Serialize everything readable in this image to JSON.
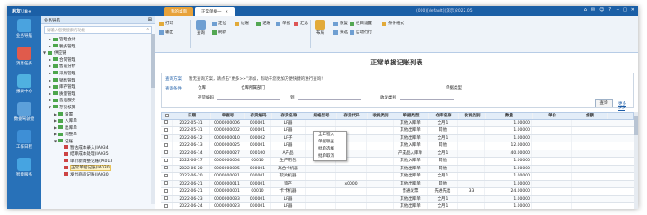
{
  "app": {
    "title": "用友U8+",
    "status": "(000)[default](演示)2022.05",
    "toolbar_right": [
      "首",
      "消息中心",
      "导航",
      "帮助"
    ],
    "tabs": [
      {
        "label": "我的桌面",
        "active": false
      },
      {
        "label": "正常单据一",
        "active": true
      }
    ]
  },
  "modules": [
    {
      "label": "业务导航",
      "color": "#4aa3df"
    },
    {
      "label": "消息任务",
      "color": "#e05b4c"
    },
    {
      "label": "报表中心",
      "color": "#4fb1e0"
    },
    {
      "label": "数据驾驶舱",
      "color": "#5ca0da"
    },
    {
      "label": "工作日程",
      "color": "#3e8fd6"
    },
    {
      "label": "智能服务",
      "color": "#46a4e1"
    }
  ],
  "nav": {
    "title": "业务导航",
    "search_placeholder": "请输入您要搜索的功能",
    "tree": [
      {
        "label": "管理会计",
        "arrow": "▶",
        "indent": 1,
        "icon": "green",
        "selected": false
      },
      {
        "label": "税务管理",
        "arrow": "▶",
        "indent": 1,
        "icon": "green",
        "selected": false
      },
      {
        "label": "供应链",
        "arrow": "▼",
        "indent": 0,
        "icon": "green",
        "selected": false
      },
      {
        "label": "合同管理",
        "arrow": "▶",
        "indent": 1,
        "icon": "green",
        "selected": false
      },
      {
        "label": "售前分析",
        "arrow": "▶",
        "indent": 1,
        "icon": "green",
        "selected": false
      },
      {
        "label": "采购管理",
        "arrow": "▶",
        "indent": 1,
        "icon": "green",
        "selected": false
      },
      {
        "label": "销售管理",
        "arrow": "▶",
        "indent": 1,
        "icon": "green",
        "selected": false
      },
      {
        "label": "库存管理",
        "arrow": "▶",
        "indent": 1,
        "icon": "green",
        "selected": false
      },
      {
        "label": "质量管理",
        "arrow": "▶",
        "indent": 1,
        "icon": "green",
        "selected": false
      },
      {
        "label": "售后服务",
        "arrow": "▶",
        "indent": 1,
        "icon": "green",
        "selected": false
      },
      {
        "label": "存货核算",
        "arrow": "▼",
        "indent": 1,
        "icon": "green",
        "selected": false
      },
      {
        "label": "设置",
        "arrow": "▶",
        "indent": 2,
        "icon": "green",
        "selected": false
      },
      {
        "label": "入库单",
        "arrow": "▶",
        "indent": 2,
        "icon": "green",
        "selected": false
      },
      {
        "label": "出库单",
        "arrow": "▶",
        "indent": 2,
        "icon": "green",
        "selected": false
      },
      {
        "label": "调整单",
        "arrow": "▶",
        "indent": 2,
        "icon": "green",
        "selected": false
      },
      {
        "label": "记账",
        "arrow": "▼",
        "indent": 2,
        "icon": "green",
        "selected": false
      },
      {
        "label": "暂估成本录入(IA034",
        "arrow": "",
        "indent": 3,
        "icon": "red",
        "selected": false
      },
      {
        "label": "结算成本处理(IA035",
        "arrow": "",
        "indent": 3,
        "icon": "red",
        "selected": false
      },
      {
        "label": "单价新调整记账(IA013",
        "arrow": "",
        "indent": 3,
        "icon": "red",
        "selected": false
      },
      {
        "label": "正常单据记账(IA030",
        "arrow": "",
        "indent": 3,
        "icon": "red",
        "selected": true
      },
      {
        "label": "发出商品记账(IA030",
        "arrow": "",
        "indent": 3,
        "icon": "red",
        "selected": false
      }
    ]
  },
  "ribbon": {
    "buttons": [
      "打印",
      "输出",
      "查询",
      "定位",
      "刷新",
      "过账",
      "记账",
      "单据",
      "汇总",
      "布局",
      "恢复",
      "栏目设置",
      "筛选",
      "自动行行",
      "条件格式"
    ]
  },
  "report": {
    "title": "正常单据记账列表",
    "query": {
      "plan_label": "查询方案:",
      "plan_hint": "暂无查询方案，请点击“更多>>”添加，有助于您更加方便快捷的进行查询!",
      "cond_label": "查询条件:",
      "fields": [
        "仓库",
        "仓库所属部门",
        "单据类型",
        "存货编码",
        "到",
        "收发类别"
      ],
      "to_label": "到",
      "btn_query": "查询",
      "more": "更多>>"
    },
    "columns": [
      "日期",
      "单据号",
      "存货编码",
      "存货名称",
      "规格型号",
      "存货代码",
      "收发类别",
      "单据类型",
      "仓库名称",
      "收发类别",
      "数量",
      "单价",
      "金额"
    ],
    "rows": [
      [
        "2022-05-31",
        "0000000006",
        "000001",
        "LP器",
        "",
        "",
        "",
        "其他入库单",
        "全月1",
        "",
        "1.00000",
        "",
        ""
      ],
      [
        "2022-05-31",
        "0000000002",
        "000001",
        "LP器",
        "",
        "",
        "",
        "其他出库单",
        "其他",
        "",
        "1.00000",
        "",
        ""
      ],
      [
        "2022-06-12",
        "0000000010",
        "000002",
        "LP子",
        "",
        "",
        "",
        "其他出库单",
        "全月1",
        "",
        "1.00000",
        "",
        ""
      ],
      [
        "2022-06-13",
        "0000000025",
        "000001",
        "LP器",
        "",
        "",
        "",
        "其他入库单",
        "其他",
        "",
        "12.00000",
        "",
        ""
      ],
      [
        "2022-06-14",
        "0000000027",
        "000100",
        "A产品",
        "",
        "",
        "",
        "产成品入库单",
        "全月1",
        "",
        "40.00000",
        "",
        ""
      ],
      [
        "2022-06-17",
        "0000000004",
        "00010",
        "生产用包",
        "",
        "",
        "",
        "其他入库单",
        "其他",
        "",
        "1.00000",
        "",
        ""
      ],
      [
        "2022-06-20",
        "0000000005",
        "000001",
        "高合卡机器",
        "",
        "",
        "",
        "其他出库单",
        "其他",
        "",
        "1.00000",
        "",
        ""
      ],
      [
        "2022-06-20",
        "0000000031",
        "000001",
        "软片机器",
        "",
        "",
        "",
        "其他出库单",
        "全月1",
        "",
        "1.00000",
        "",
        ""
      ],
      [
        "2022-06-21",
        "0000000011",
        "000001",
        "资产",
        "",
        "x0000",
        "",
        "其他出库单",
        "其他",
        "",
        "1.00000",
        "",
        ""
      ],
      [
        "2022-06-21",
        "0000000001",
        "00010",
        "卡卡机器",
        "",
        "",
        "",
        "普通发票",
        "先进先出",
        "33",
        "24.00000",
        "",
        ""
      ],
      [
        "2022-06-23",
        "0000000033",
        "000001",
        "LP器",
        "",
        "",
        "",
        "其他出库单",
        "全月1",
        "",
        "1.00000",
        "",
        ""
      ],
      [
        "2022-06-24",
        "0000000023",
        "000001",
        "LP器",
        "",
        "",
        "",
        "其他出库单",
        "全月1",
        "",
        "1.00000",
        "",
        ""
      ]
    ],
    "context_menu": [
      "全工程入",
      "单据联查",
      "批单选择",
      "批单取消"
    ]
  }
}
